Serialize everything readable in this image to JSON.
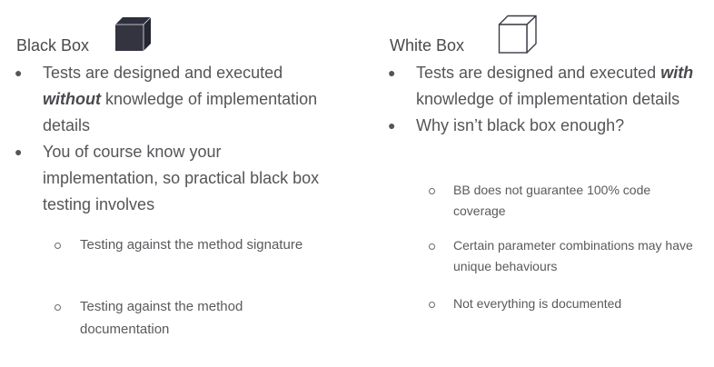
{
  "black_box": {
    "title": "Black Box",
    "icon": "filled-cube-icon",
    "cube_color": "#2e2f3d",
    "points": [
      {
        "before": "Tests are designed and executed ",
        "emphasis": "without",
        "after": " knowledge of implementation details"
      },
      {
        "text": "You of course know your implementation, so practical black box testing involves"
      }
    ],
    "sub_points": [
      "Testing against the method signature",
      "Testing against the method documentation"
    ]
  },
  "white_box": {
    "title": "White Box",
    "icon": "outline-cube-icon",
    "cube_color": "#3c3c46",
    "points": [
      {
        "before": "Tests are designed and executed ",
        "emphasis": "with",
        "after": " knowledge of implementation details"
      },
      {
        "text": "Why isn’t black box enough?"
      }
    ],
    "sub_points": [
      "BB does not guarantee 100% code coverage",
      "Certain parameter combinations may have unique behaviours",
      "Not everything is documented"
    ]
  }
}
